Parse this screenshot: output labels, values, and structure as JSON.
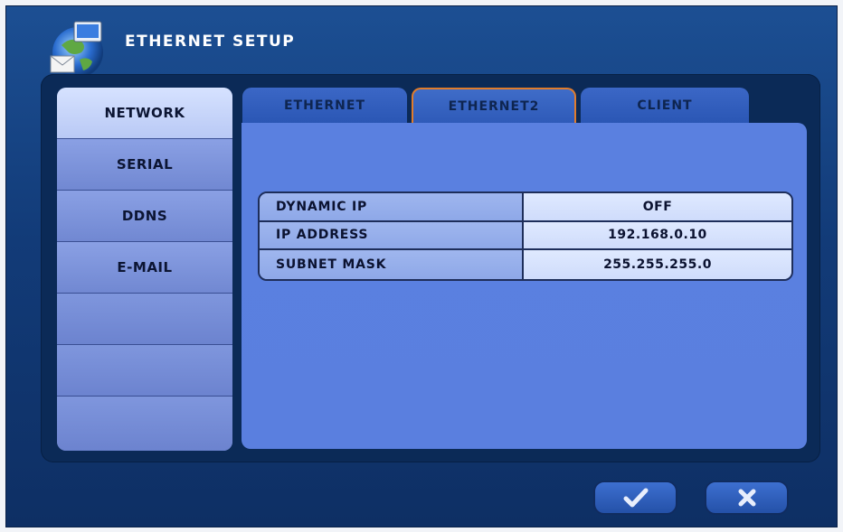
{
  "window": {
    "title": "ETHERNET SETUP"
  },
  "sidebar": {
    "items": [
      {
        "label": "NETWORK"
      },
      {
        "label": "SERIAL"
      },
      {
        "label": "DDNS"
      },
      {
        "label": "E-MAIL"
      },
      {
        "label": ""
      },
      {
        "label": ""
      },
      {
        "label": ""
      }
    ],
    "active_index": 0
  },
  "tabs": [
    {
      "label": "ETHERNET"
    },
    {
      "label": "ETHERNET2"
    },
    {
      "label": "CLIENT"
    }
  ],
  "active_tab_index": 1,
  "settings": [
    {
      "label": "DYNAMIC IP",
      "value": "OFF"
    },
    {
      "label": "IP ADDRESS",
      "value": "192.168.0.10"
    },
    {
      "label": "SUBNET MASK",
      "value": "255.255.255.0"
    }
  ],
  "buttons": {
    "confirm": {
      "icon": "checkmark-icon"
    },
    "cancel": {
      "icon": "close-icon"
    }
  },
  "colors": {
    "window_bg": "#123b78",
    "panel_bg": "#5a7fdf",
    "active_tab_border": "#e07c2c"
  }
}
